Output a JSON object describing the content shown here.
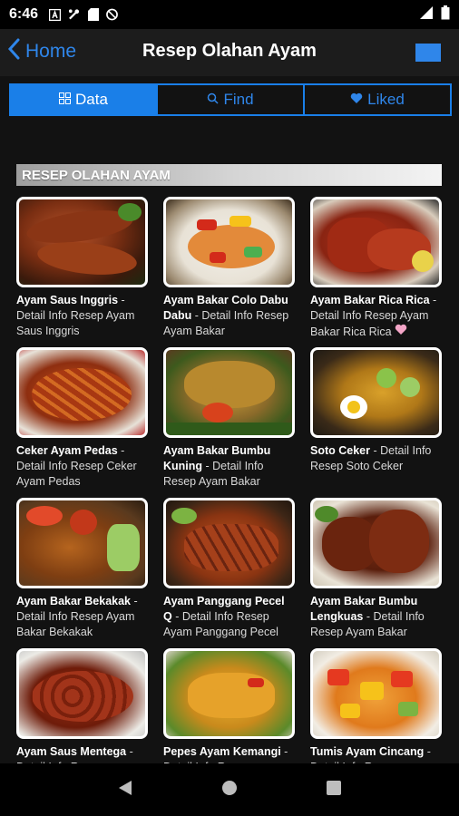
{
  "status": {
    "time": "6:46"
  },
  "header": {
    "back_label": "Home",
    "title": "Resep Olahan Ayam"
  },
  "tabs": [
    {
      "label": "Data",
      "icon": "grid-icon",
      "active": true
    },
    {
      "label": "Find",
      "icon": "search-icon",
      "active": false
    },
    {
      "label": "Liked",
      "icon": "heart-icon",
      "active": false
    }
  ],
  "section": {
    "title": "RESEP OLAHAN AYAM"
  },
  "recipes": [
    {
      "title": "Ayam Saus Inggris",
      "desc": " - Detail Info Resep Ayam Saus Inggris",
      "liked": false
    },
    {
      "title": "Ayam Bakar Colo Dabu Dabu",
      "desc": " - Detail Info Resep Ayam Bakar",
      "liked": false
    },
    {
      "title": "Ayam Bakar Rica Rica",
      "desc": " - Detail Info Resep Ayam Bakar Rica Rica",
      "liked": true
    },
    {
      "title": "Ceker Ayam Pedas",
      "desc": " - Detail Info Resep Ceker Ayam Pedas",
      "liked": false
    },
    {
      "title": "Ayam Bakar Bumbu Kuning",
      "desc": " - Detail Info Resep Ayam Bakar",
      "liked": false
    },
    {
      "title": "Soto Ceker",
      "desc": " - Detail Info Resep Soto Ceker",
      "liked": false
    },
    {
      "title": "Ayam Bakar Bekakak",
      "desc": " - Detail Info Resep Ayam Bakar Bekakak",
      "liked": false
    },
    {
      "title": "Ayam Panggang Pecel Q",
      "desc": " - Detail Info Resep Ayam Panggang Pecel",
      "liked": false
    },
    {
      "title": "Ayam Bakar Bumbu Lengkuas",
      "desc": " - Detail Info Resep Ayam Bakar",
      "liked": false
    },
    {
      "title": "Ayam Saus Mentega",
      "desc": " - Detail Info Resep",
      "liked": false
    },
    {
      "title": "Pepes Ayam Kemangi",
      "desc": " - Detail Info Resep",
      "liked": false
    },
    {
      "title": "Tumis Ayam Cincang",
      "desc": " - Detail Info Resep",
      "liked": false
    }
  ],
  "colors": {
    "accent": "#1a7fe8",
    "background": "#121212",
    "liked": "#f4a6c8"
  }
}
